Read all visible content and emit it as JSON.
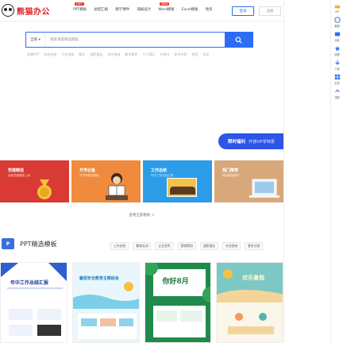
{
  "header": {
    "brand": "熊猫办公",
    "nav": [
      {
        "label": "PPT模板",
        "badge": "HOT"
      },
      {
        "label": "总结汇报",
        "badge": ""
      },
      {
        "label": "教学课件",
        "badge": ""
      },
      {
        "label": "海报设计",
        "badge": ""
      },
      {
        "label": "Word模板",
        "badge": "NEW"
      },
      {
        "label": "Excel模板",
        "badge": ""
      },
      {
        "label": "更多",
        "badge": ""
      }
    ],
    "login": "登录",
    "register": "注册"
  },
  "search": {
    "category": "全部 ▾",
    "placeholder": "搜索海量精品模板"
  },
  "hotwords": [
    "党建PPT",
    "年终总结",
    "工作总结",
    "简历",
    "述职报告",
    "毕业答辩",
    "教学课件",
    "个人简历",
    "计划书",
    "读书分享",
    "合同",
    "年会"
  ],
  "promo": {
    "a": "限时福利",
    "b": "开通VIP享特惠"
  },
  "banners": [
    {
      "title": "党建精选",
      "sub": "全新党建模板上线"
    },
    {
      "title": "开学必备",
      "sub": "开学季精选模板"
    },
    {
      "title": "工作总结",
      "sub": "年中工作总结汇报"
    },
    {
      "title": "热门推荐",
      "sub": "精品模板推荐"
    }
  ],
  "more_link": "查看全部模板 >",
  "ppt_section": {
    "icon_text": "P",
    "title": "PPT精选模板",
    "tabs": [
      "工作总结",
      "教育培训",
      "企业宣传",
      "营销策划",
      "述职报告",
      "毕业答辩",
      "更多分类"
    ]
  },
  "cards": [
    {
      "title": "年中工作总结汇报"
    },
    {
      "title": "暑假安全教育主题班会"
    },
    {
      "title": "你好8月"
    },
    {
      "title": "欢乐暑假"
    }
  ],
  "sidebar": [
    "VIP",
    "客服",
    "消息",
    "收藏",
    "下载",
    "反馈",
    "顶部"
  ],
  "colors": {
    "primary": "#2d6cf5",
    "brand_red": "#e02020"
  }
}
